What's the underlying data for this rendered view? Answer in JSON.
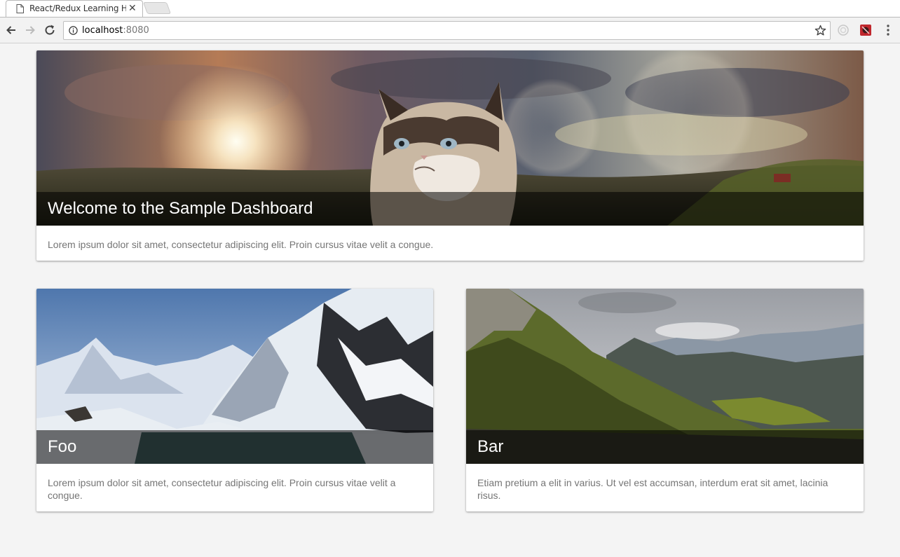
{
  "browser": {
    "tab_title": "React/Redux Learning Ho",
    "tab_close": "✕",
    "url_host": "localhost",
    "url_port": ":8080"
  },
  "cards": [
    {
      "title": "Welcome to the Sample Dashboard",
      "text": "Lorem ipsum dolor sit amet, consectetur adipiscing elit. Proin cursus vitae velit a congue.",
      "image": "cat-landscape-image"
    },
    {
      "title": "Foo",
      "text": "Lorem ipsum dolor sit amet, consectetur adipiscing elit. Proin cursus vitae velit a congue.",
      "image": "snowy-mountains-image"
    },
    {
      "title": "Bar",
      "text": "Etiam pretium a elit in varius. Ut vel est accumsan, interdum erat sit amet, lacinia risus.",
      "image": "green-mountains-image"
    }
  ],
  "icons": {
    "back": "back-arrow-icon",
    "forward": "forward-arrow-icon",
    "reload": "reload-icon",
    "info": "info-icon",
    "bookmark": "star-icon",
    "menu": "kebab-menu-icon"
  },
  "colors": {
    "page_background": "#f4f4f4",
    "card_background": "#ffffff",
    "title_overlay": "rgba(0,0,0,0.55)",
    "body_text": "#757575"
  }
}
